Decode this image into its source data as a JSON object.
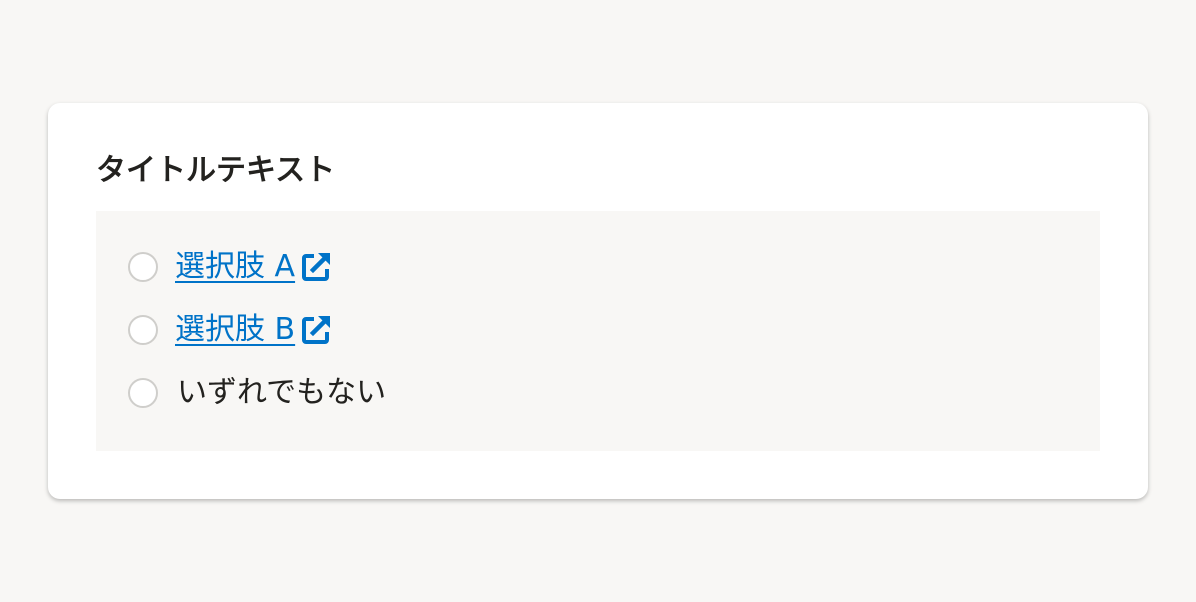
{
  "card": {
    "title": "タイトルテキスト"
  },
  "options": [
    {
      "label": "選択肢 A",
      "kind": "link",
      "icon": "external-link-icon",
      "selected": false
    },
    {
      "label": "選択肢 B",
      "kind": "link",
      "icon": "external-link-icon",
      "selected": false
    },
    {
      "label": "いずれでもない",
      "kind": "text",
      "selected": false
    }
  ],
  "colors": {
    "page_background": "#f8f7f5",
    "card_background": "#ffffff",
    "link": "#0073c8",
    "text": "#23221f",
    "radio_border": "#cfcecb"
  }
}
